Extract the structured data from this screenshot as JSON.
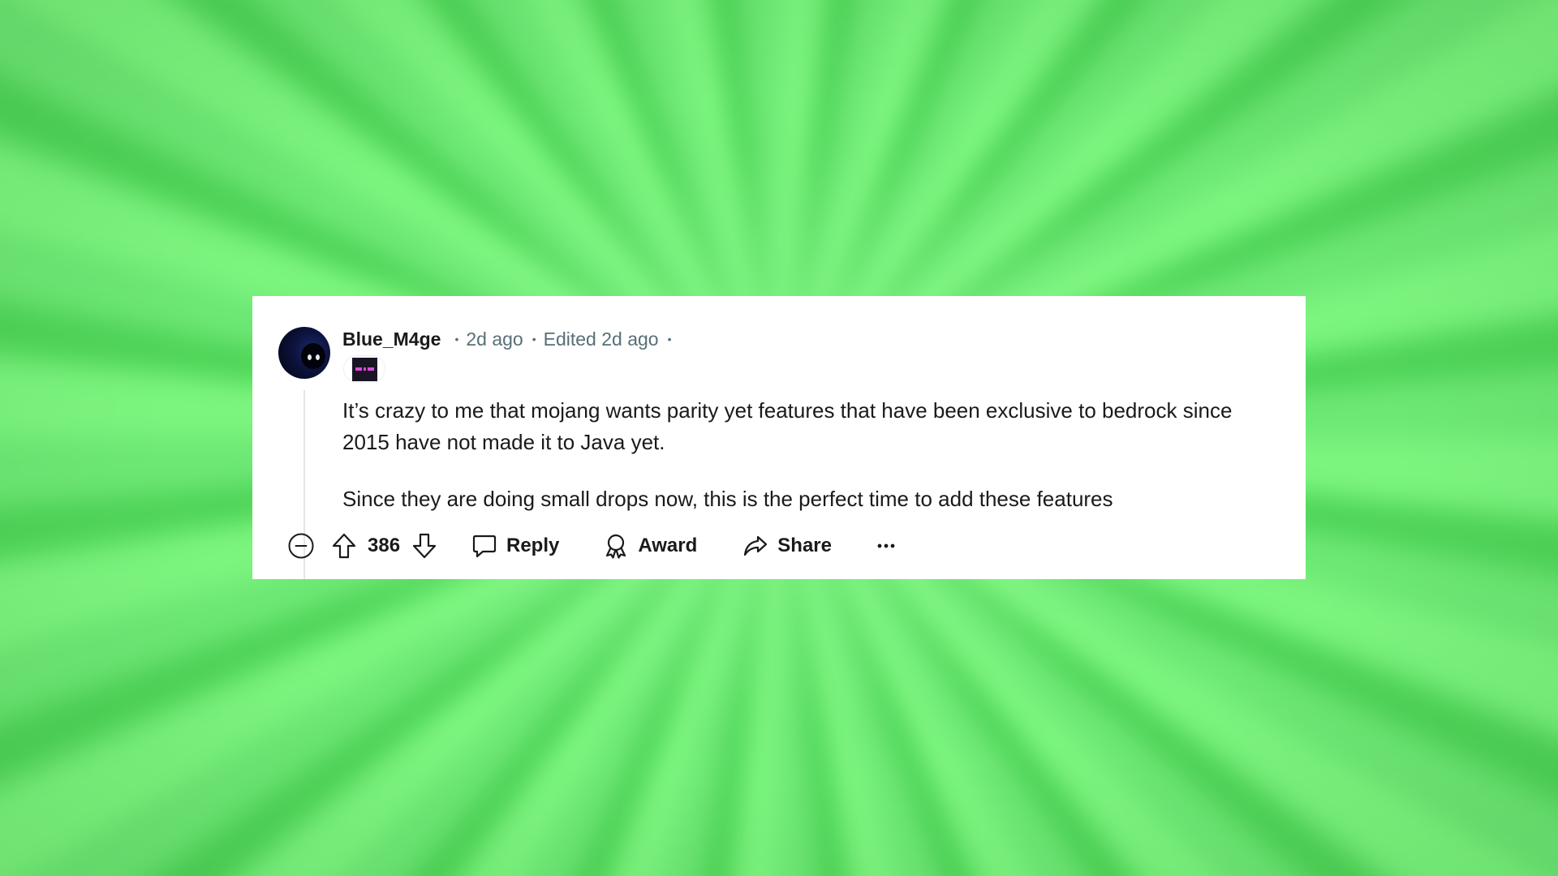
{
  "comment": {
    "username": "Blue_M4ge",
    "posted": "2d ago",
    "edited": "Edited 2d ago",
    "paragraphs": [
      "It’s crazy to me that mojang wants parity yet features that have been exclusive to bedrock since 2015 have not made it to Java yet.",
      "Since they are doing small drops now, this is the perfect time to add these features"
    ]
  },
  "actions": {
    "score": "386",
    "reply_label": "Reply",
    "award_label": "Award",
    "share_label": "Share"
  },
  "icons": {
    "collapse": "collapse-minus-icon",
    "upvote": "arrow-up-icon",
    "downvote": "arrow-down-icon",
    "reply": "speech-bubble-icon",
    "award": "ribbon-award-icon",
    "share": "curved-arrow-icon",
    "more": "ellipsis-icon"
  },
  "colors": {
    "background": "#6ee875",
    "card": "#ffffff",
    "text": "#1a1a1b",
    "meta": "#576f76",
    "flair_accent": "#d94cd9"
  }
}
